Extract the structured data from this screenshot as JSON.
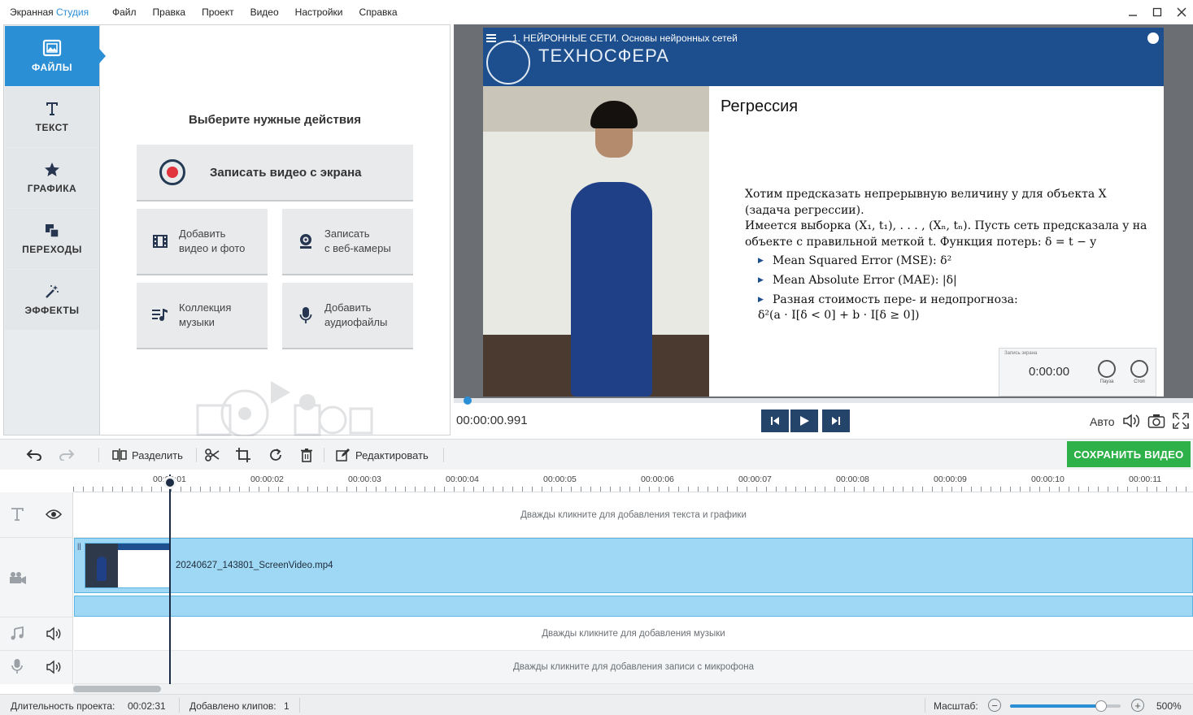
{
  "app": {
    "name_part1": "Экранная ",
    "name_part2": "Студия",
    "accent_color": "#2b8fd6"
  },
  "menu": [
    "Файл",
    "Правка",
    "Проект",
    "Видео",
    "Настройки",
    "Справка"
  ],
  "window_controls": [
    "minimize-icon",
    "maximize-icon",
    "close-icon"
  ],
  "tabs": [
    {
      "label": "ФАЙЛЫ",
      "icon": "image-icon",
      "active": true
    },
    {
      "label": "ТЕКСТ",
      "icon": "text-icon"
    },
    {
      "label": "ГРАФИКА",
      "icon": "star-icon"
    },
    {
      "label": "ПЕРЕХОДЫ",
      "icon": "transition-icon"
    },
    {
      "label": "ЭФФЕКТЫ",
      "icon": "magic-wand-icon"
    }
  ],
  "actions": {
    "title": "Выберите нужные действия",
    "record": "Записать видео с экрана",
    "add_media": [
      "Добавить",
      "видео и фото"
    ],
    "webcam": [
      "Записать",
      "с веб-камеры"
    ],
    "music": [
      "Коллекция",
      "музыки"
    ],
    "audio": [
      "Добавить",
      "аудиофайлы"
    ]
  },
  "preview": {
    "frame_title": "1. НЕЙРОННЫЕ СЕТИ. Основы нейронных сетей",
    "frame_logo": "ТЕХНОСФЕРА",
    "slide_title": "Регрессия",
    "slide_line1": "Хотим предсказать непрерывную величину y для объекта X (задача регрессии).",
    "slide_line2": "Имеется выборка (X₁, t₁), . . . , (Xₙ, tₙ). Пусть сеть предсказала y на объекте с правильной меткой t. Функция потерь: δ = t − y",
    "bullets": [
      "Mean Squared Error (MSE): δ²",
      "Mean Absolute Error (MAE): |δ|",
      "Разная стоимость пере- и недопрогноза:"
    ],
    "formula": "δ²(a · I[δ < 0] + b · I[δ ≥ 0])",
    "widget_title": "Запись экрана",
    "widget_time": "0:00:00",
    "widget_pause": "Пауза",
    "widget_stop": "Стоп",
    "timecode": "00:00:00.991",
    "quality": "Авто",
    "progress": 0.005
  },
  "toolbar": {
    "split": "Разделить",
    "edit": "Редактировать",
    "save": "СОХРАНИТЬ ВИДЕО",
    "save_color": "#2fb14a"
  },
  "timeline": {
    "ruler": [
      "00:00:01",
      "00:00:02",
      "00:00:03",
      "00:00:04",
      "00:00:05",
      "00:00:06",
      "00:00:07",
      "00:00:08",
      "00:00:09",
      "00:00:10",
      "00:00:11"
    ],
    "text_hint": "Дважды кликните для добавления текста и графики",
    "clip_name": "20240627_143801_ScreenVideo.mp4",
    "music_hint": "Дважды кликните для добавления музыки",
    "mic_hint": "Дважды кликните для добавления записи с микрофона"
  },
  "status": {
    "duration_label": "Длительность проекта:",
    "duration": "00:02:31",
    "clips_label": "Добавлено клипов:",
    "clips": "1",
    "zoom_label": "Масштаб:",
    "zoom_value": "500%",
    "zoom_fraction": 0.82
  }
}
